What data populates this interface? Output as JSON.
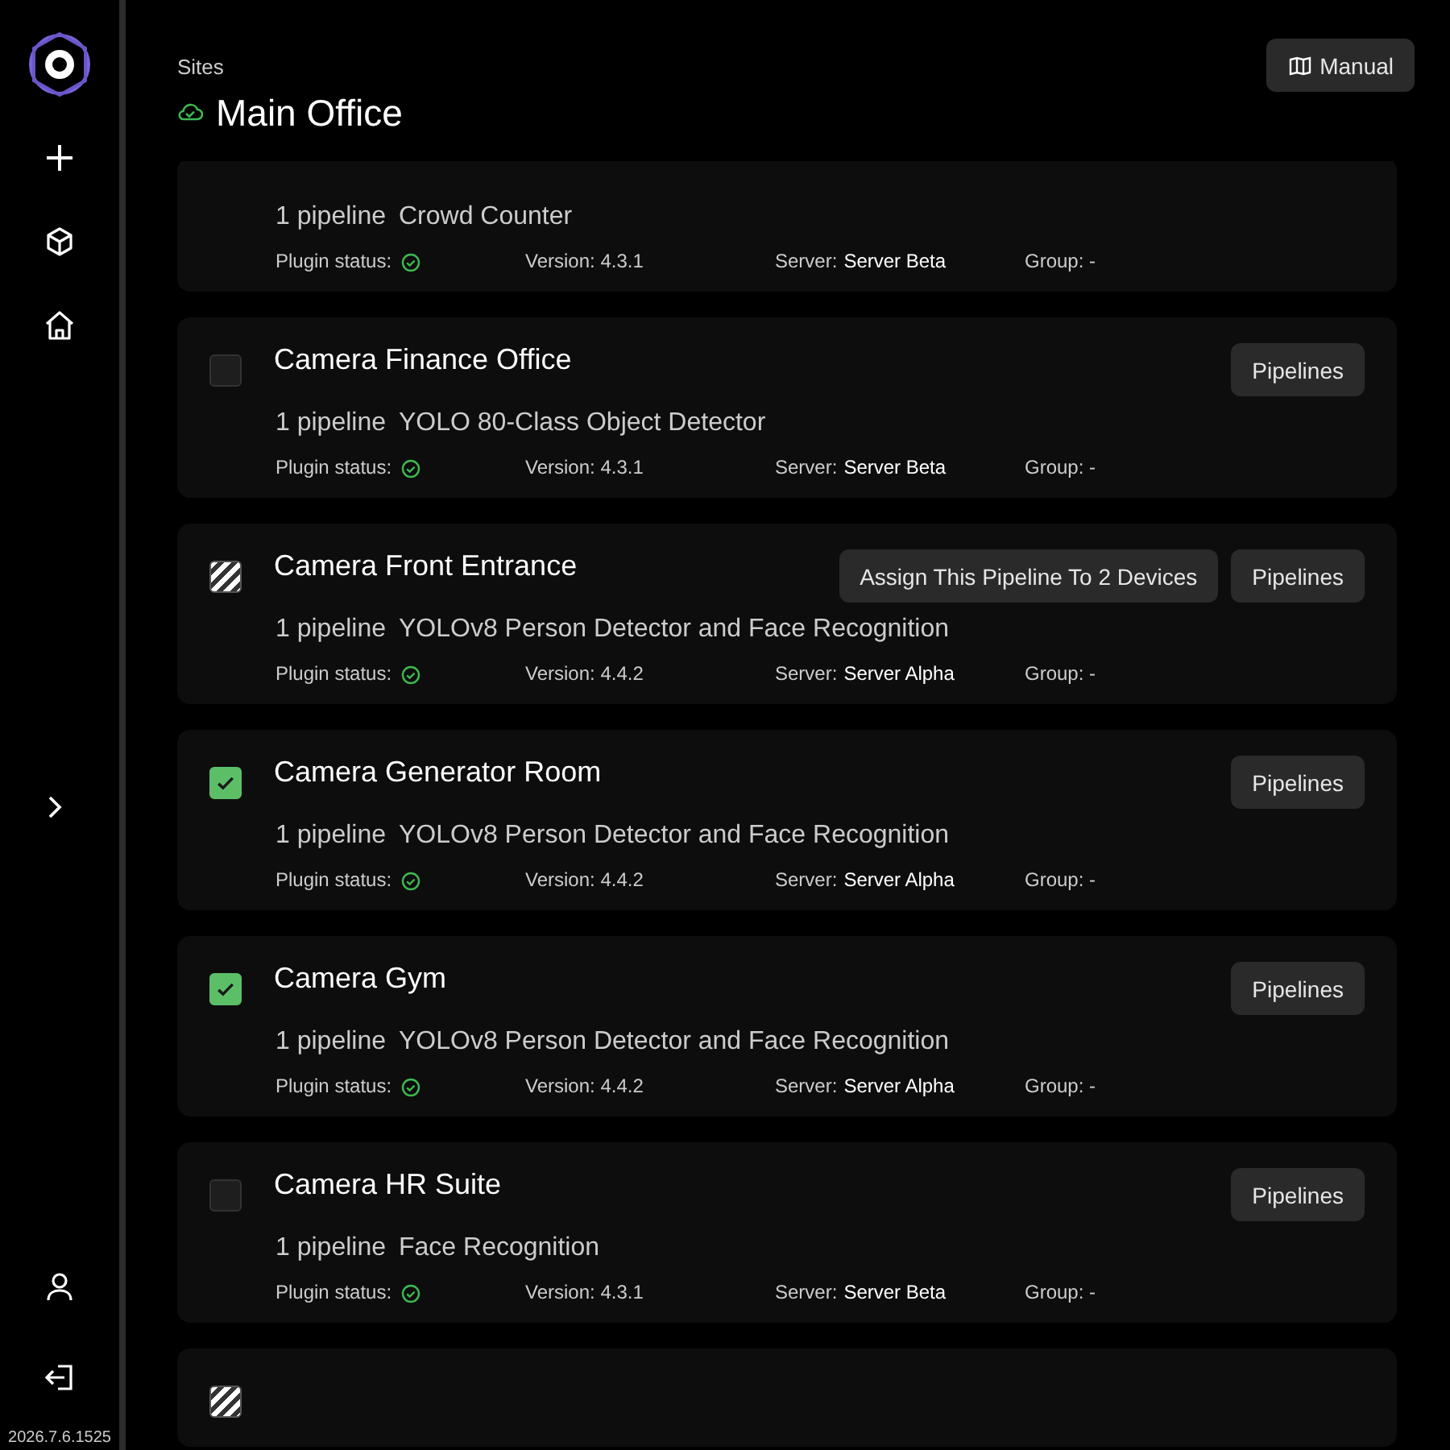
{
  "sidebar": {
    "version": "2026.7.6.1525"
  },
  "header": {
    "breadcrumb": "Sites",
    "title": "Main Office",
    "cloud_ok": true,
    "manual_button": "Manual"
  },
  "devices": [
    {
      "kind": "cut",
      "pipeline_count": "1 pipeline",
      "pipeline": "Crowd Counter",
      "plugin_status_label": "Plugin status:",
      "plugin_ok": true,
      "version": "Version: 4.3.1",
      "server_label": "Server:",
      "server": "Server Beta",
      "group": "Group: -"
    },
    {
      "kind": "selectable",
      "checked": false,
      "title": "Camera Finance Office",
      "buttons": [
        "Pipelines"
      ],
      "pipeline_count": "1 pipeline",
      "pipeline": "YOLO 80-Class Object Detector",
      "plugin_status_label": "Plugin status:",
      "plugin_ok": true,
      "version": "Version: 4.3.1",
      "server_label": "Server:",
      "server": "Server Beta",
      "group": "Group: -"
    },
    {
      "kind": "selectable",
      "checked": true,
      "indeterminate": true,
      "title": "Camera Front Entrance",
      "buttons": [
        "Assign This Pipeline To 2 Devices",
        "Pipelines"
      ],
      "pipeline_count": "1 pipeline",
      "pipeline": "YOLOv8 Person Detector and Face Recognition",
      "plugin_status_label": "Plugin status:",
      "plugin_ok": true,
      "version": "Version: 4.4.2",
      "server_label": "Server:",
      "server": "Server Alpha",
      "group": "Group: -"
    },
    {
      "kind": "selectable",
      "checked": true,
      "title": "Camera Generator Room",
      "buttons": [
        "Pipelines"
      ],
      "pipeline_count": "1 pipeline",
      "pipeline": "YOLOv8 Person Detector and Face Recognition",
      "plugin_status_label": "Plugin status:",
      "plugin_ok": true,
      "version": "Version: 4.4.2",
      "server_label": "Server:",
      "server": "Server Alpha",
      "group": "Group: -"
    },
    {
      "kind": "selectable",
      "checked": true,
      "title": "Camera Gym",
      "buttons": [
        "Pipelines"
      ],
      "pipeline_count": "1 pipeline",
      "pipeline": "YOLOv8 Person Detector and Face Recognition",
      "plugin_status_label": "Plugin status:",
      "plugin_ok": true,
      "version": "Version: 4.4.2",
      "server_label": "Server:",
      "server": "Server Alpha",
      "group": "Group: -"
    },
    {
      "kind": "selectable",
      "checked": false,
      "title": "Camera HR Suite",
      "buttons": [
        "Pipelines"
      ],
      "pipeline_count": "1 pipeline",
      "pipeline": "Face Recognition",
      "plugin_status_label": "Plugin status:",
      "plugin_ok": true,
      "version": "Version: 4.3.1",
      "server_label": "Server:",
      "server": "Server Beta",
      "group": "Group: -"
    },
    {
      "kind": "selectable",
      "checked": true,
      "indeterminate": true
    }
  ]
}
